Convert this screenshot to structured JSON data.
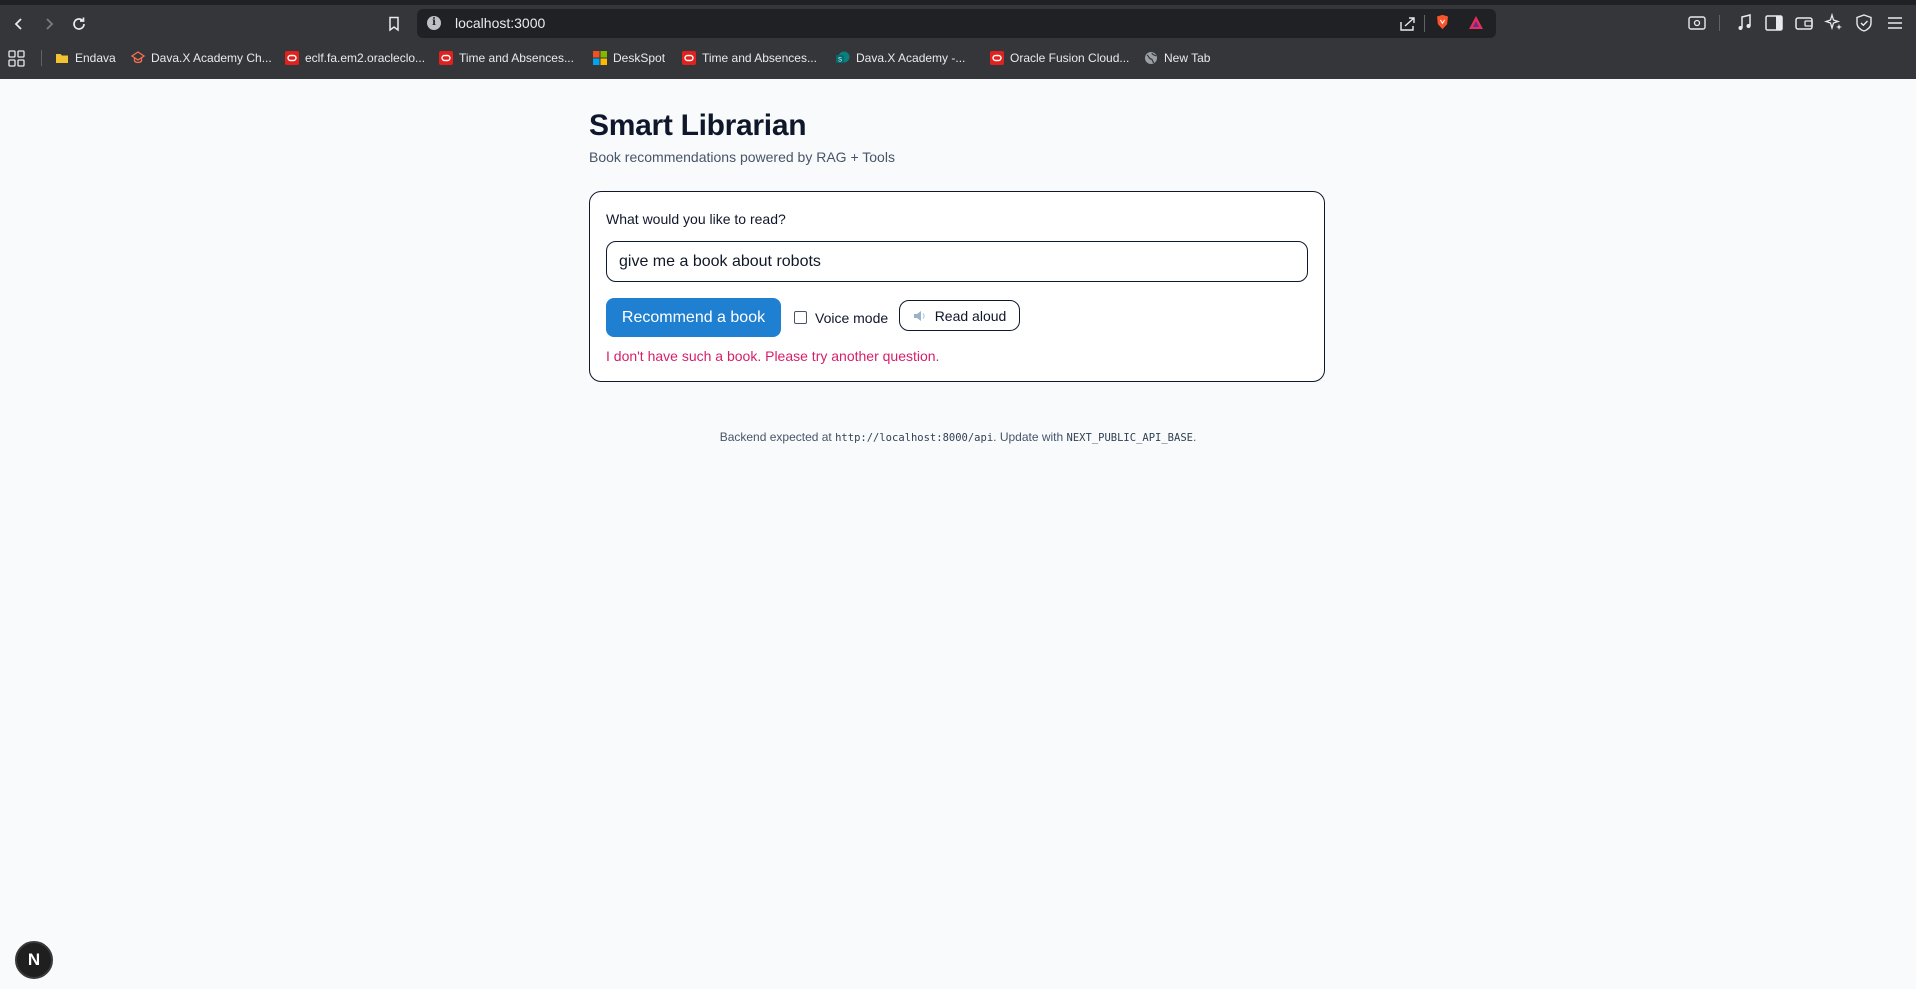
{
  "browser": {
    "url": "localhost:3000",
    "bookmarks": [
      {
        "label": "Endava",
        "icon": "folder-icon"
      },
      {
        "label": "Dava.X Academy Ch...",
        "icon": "academy-icon"
      },
      {
        "label": "eclf.fa.em2.oracleclo...",
        "icon": "oracle-icon"
      },
      {
        "label": "Time and Absences...",
        "icon": "oracle-icon"
      },
      {
        "label": "DeskSpot",
        "icon": "microsoft-icon"
      },
      {
        "label": "Time and Absences...",
        "icon": "oracle-icon"
      },
      {
        "label": "Dava.X Academy -...",
        "icon": "sharepoint-icon"
      },
      {
        "label": "Oracle Fusion Cloud...",
        "icon": "oracle-icon"
      },
      {
        "label": "New Tab",
        "icon": "globe-icon"
      }
    ]
  },
  "app": {
    "title": "Smart Librarian",
    "subtitle": "Book recommendations powered by RAG + Tools"
  },
  "form": {
    "label": "What would you like to read?",
    "query_value": "give me a book about robots",
    "submit_label": "Recommend a book",
    "voice_mode_label": "Voice mode",
    "voice_mode_checked": false,
    "read_aloud_label": "Read aloud",
    "error_message": "I don't have such a book. Please try another question."
  },
  "footer": {
    "prefix": "Backend expected at ",
    "api_url": "http://localhost:8000/api",
    "middle": ". Update with ",
    "env_var": "NEXT_PUBLIC_API_BASE",
    "suffix": "."
  },
  "dev_badge": {
    "letter": "N"
  },
  "colors": {
    "accent": "#1f7fd1",
    "error": "#d61f69",
    "page_bg": "#f8fafc",
    "chrome_bg": "#35363a"
  }
}
